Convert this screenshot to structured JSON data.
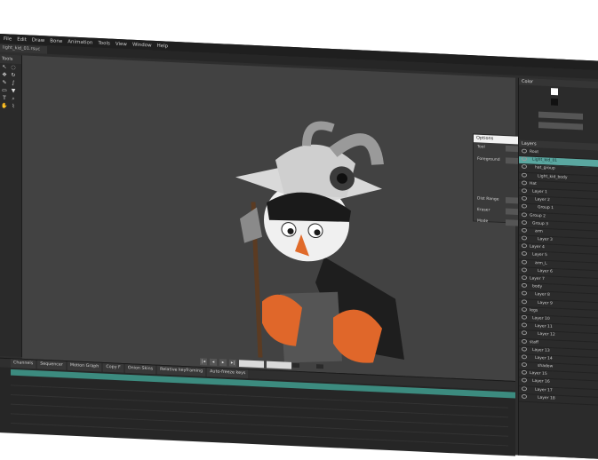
{
  "menu": [
    "File",
    "Edit",
    "Draw",
    "Bone",
    "Animation",
    "Tools",
    "View",
    "Window",
    "Help"
  ],
  "document_tab": "light_kid_01.rsuc",
  "tools_title": "Tools",
  "tool_icons": [
    "pointer-icon",
    "lasso-icon",
    "move-icon",
    "rotate-icon",
    "pen-icon",
    "brush-icon",
    "eraser-icon",
    "fill-icon",
    "text-icon",
    "zoom-icon",
    "hand-icon",
    "eyedropper-icon"
  ],
  "options_panel": {
    "title": "Options",
    "rows": [
      "Tool",
      "Foreground",
      "Dist Range",
      "Eraser",
      "Mode"
    ]
  },
  "right_panel": {
    "top_title": "Color",
    "layers_title": "Layers",
    "layers": [
      "Root",
      "Light_kid_01",
      "hat_group",
      "Light_kid_body",
      "Hat",
      "Layer 1",
      "Layer 2",
      "Group 1",
      "Group 2",
      "Group 3",
      "arm",
      "Layer 3",
      "Layer 4",
      "Layer 5",
      "arm_L",
      "Layer 6",
      "Layer 7",
      "body",
      "Layer 8",
      "Layer 9",
      "legs",
      "Layer 10",
      "Layer 11",
      "Layer 12",
      "staff",
      "Layer 13",
      "Layer 14",
      "shadow",
      "Layer 15",
      "Layer 16",
      "Layer 17",
      "Layer 18"
    ],
    "selected_index": 1
  },
  "timeline": {
    "tabs": [
      "Channels",
      "Sequencer",
      "Motion Graph",
      "Copy F",
      "Onion Skins",
      "Relative keyframing",
      "Auto-freeze keys"
    ]
  }
}
